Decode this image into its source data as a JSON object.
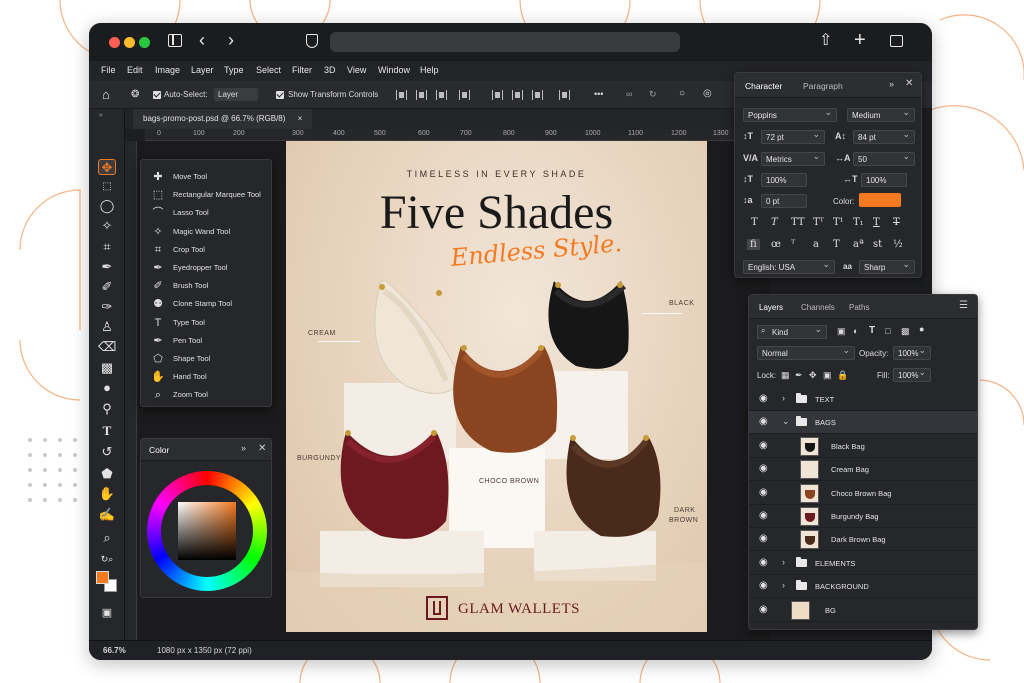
{
  "window": {
    "tab_title": "bags-promo-post.psd @ 66.7% (RGB/8)",
    "tab_close": "×"
  },
  "menu": [
    "File",
    "Edit",
    "Image",
    "Layer",
    "Type",
    "Select",
    "Filter",
    "3D",
    "View",
    "Window",
    "Help"
  ],
  "options": {
    "auto_select_label": "Auto-Select:",
    "auto_select_value": "Layer",
    "show_transform_label": "Show Transform Controls",
    "more": "•••"
  },
  "ruler": [
    "0",
    "100",
    "200",
    "300",
    "400",
    "500",
    "600",
    "700",
    "800",
    "900",
    "1000",
    "1100",
    "1200",
    "1300"
  ],
  "status": {
    "zoom": "66.7%",
    "doc_size": "1080 px x 1350 px (72 ppi)"
  },
  "tool_flyout": [
    {
      "icon": "move-icon",
      "glyph": "✚",
      "label": "Move Tool"
    },
    {
      "icon": "marquee-icon",
      "glyph": "⬚",
      "label": "Rectangular Marquee Tool"
    },
    {
      "icon": "lasso-icon",
      "glyph": "⌒",
      "label": "Lasso Tool"
    },
    {
      "icon": "magic-wand-icon",
      "glyph": "✧",
      "label": "Magic Wand Tool"
    },
    {
      "icon": "crop-icon",
      "glyph": "⌗",
      "label": "Crop Tool"
    },
    {
      "icon": "eyedropper-icon",
      "glyph": "✒",
      "label": "Eyedropper Tool"
    },
    {
      "icon": "brush-icon",
      "glyph": "✐",
      "label": "Brush Tool"
    },
    {
      "icon": "clone-stamp-icon",
      "glyph": "⚉",
      "label": "Clone Stamp Tool"
    },
    {
      "icon": "type-icon",
      "glyph": "T",
      "label": "Type Tool"
    },
    {
      "icon": "pen-icon",
      "glyph": "✒",
      "label": "Pen Tool"
    },
    {
      "icon": "shape-icon",
      "glyph": "⬠",
      "label": "Shape Tool"
    },
    {
      "icon": "hand-icon",
      "glyph": "✋",
      "label": "Hand Tool"
    },
    {
      "icon": "zoom-icon",
      "glyph": "⌕",
      "label": "Zoom Tool"
    }
  ],
  "color_panel": {
    "title": "Color",
    "foreground": "#f47a20",
    "background": "#ffffff"
  },
  "poster": {
    "tagline": "TIMELESS IN EVERY SHADE",
    "headline": "Five Shades",
    "script": "Endless Style.",
    "brand": "GLAM WALLETS",
    "callouts": {
      "cream": "CREAM",
      "black": "BLACK",
      "burgundy": "BURGUNDY",
      "choco": "CHOCO BROWN",
      "dark1": "DARK",
      "dark2": "BROWN"
    },
    "colors": {
      "cream": "#efe6d8",
      "black": "#151515",
      "burgundy": "#6e1820",
      "choco": "#8a4520",
      "dark": "#4a2a1a",
      "accent": "#f47a20",
      "brand": "#6a1a1e"
    }
  },
  "character": {
    "tab_active": "Character",
    "tab_other": "Paragraph",
    "font": "Poppins",
    "weight": "Medium",
    "size": "72 pt",
    "leading": "84 pt",
    "kerning": "Metrics",
    "tracking": "50",
    "vscale": "100%",
    "hscale": "100%",
    "baseline": "0 pt",
    "color_label": "Color:",
    "color_value": "#f47a20",
    "language": "English: USA",
    "aa_glyph": "aa",
    "antialias": "Sharp"
  },
  "layers": {
    "tabs": [
      "Layers",
      "Channels",
      "Paths"
    ],
    "filter": "Kind",
    "blend": "Normal",
    "opacity_label": "Opacity:",
    "opacity": "100%",
    "lock_label": "Lock:",
    "fill_label": "Fill:",
    "fill": "100%",
    "rows": [
      {
        "type": "group",
        "name": "TEXT",
        "open": false
      },
      {
        "type": "group",
        "name": "BAGS",
        "open": true
      },
      {
        "type": "layer",
        "name": "Black Bag",
        "swatch": "#151515"
      },
      {
        "type": "layer",
        "name": "Cream Bag",
        "swatch": "#efe6d8"
      },
      {
        "type": "layer",
        "name": "Choco Brown Bag",
        "swatch": "#8a4520"
      },
      {
        "type": "layer",
        "name": "Burgundy Bag",
        "swatch": "#6e1820"
      },
      {
        "type": "layer",
        "name": "Dark Brown Bag",
        "swatch": "#4a2a1a"
      },
      {
        "type": "group",
        "name": "ELEMENTS",
        "open": false
      },
      {
        "type": "group",
        "name": "BACKGROUND",
        "open": false
      },
      {
        "type": "layer",
        "name": "BG",
        "swatch": "#f0dcc6"
      }
    ]
  }
}
